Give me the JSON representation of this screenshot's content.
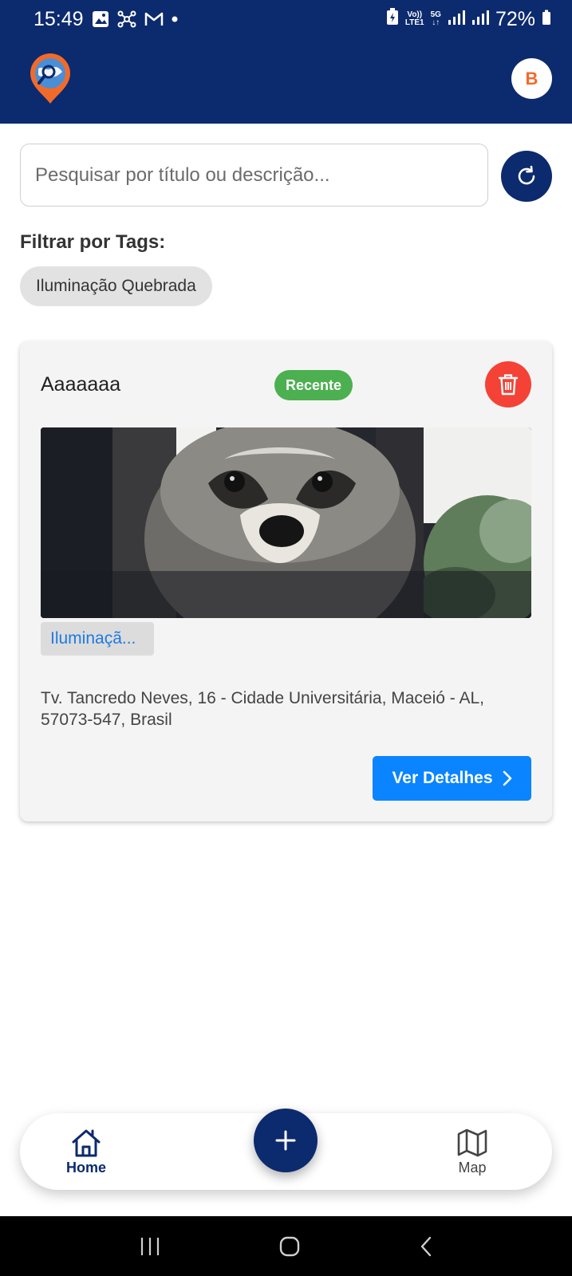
{
  "status_bar": {
    "time": "15:49",
    "network_top": "Vo))",
    "network_bottom": "LTE1",
    "fiveg_top": "5G",
    "fiveg_bottom": "↓↑",
    "battery": "72%"
  },
  "header": {
    "avatar_initial": "B",
    "brand_color": "#0c2a6e",
    "avatar_color": "#f26a2a"
  },
  "search": {
    "placeholder": "Pesquisar por título ou descrição..."
  },
  "filters": {
    "label": "Filtrar por Tags:",
    "tags": [
      "Iluminação Quebrada"
    ]
  },
  "card": {
    "title": "Aaaaaaa",
    "badge": "Recente",
    "badge_color": "#4caf50",
    "image_description_icon": "raccoon-photo",
    "tag": "Iluminaçã...",
    "address": "Tv. Tancredo Neves, 16 - Cidade Universitária, Maceió - AL, 57073-547, Brasil",
    "details_button": "Ver Detalhes",
    "delete_color": "#f44336",
    "details_color": "#0a84ff"
  },
  "bottom_nav": {
    "home_label": "Home",
    "map_label": "Map"
  }
}
